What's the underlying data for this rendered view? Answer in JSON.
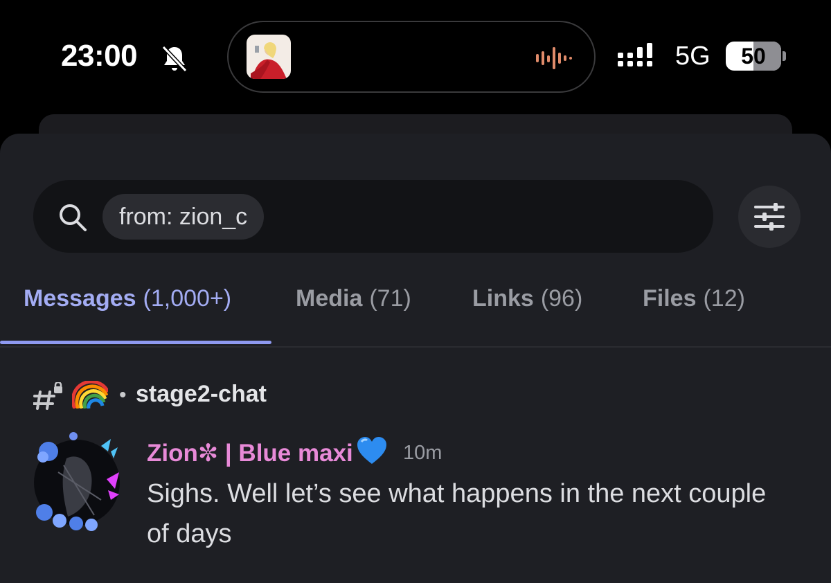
{
  "status_bar": {
    "time": "23:00",
    "bell_icon": "bell-slash-icon",
    "network": "5G",
    "battery": "50",
    "battery_level": 0.5
  },
  "search": {
    "filter_chip": "from: zion_c"
  },
  "tabs": [
    {
      "label": "Messages",
      "count": "(1,000+)",
      "active": true
    },
    {
      "label": "Media",
      "count": "(71)"
    },
    {
      "label": "Links",
      "count": "(96)"
    },
    {
      "label": "Files",
      "count": "(12)"
    }
  ],
  "result": {
    "channel": "stage2-chat",
    "author": "Zion✼ | Blue maxi",
    "time": "10m",
    "text": "Sighs. Well let’s see what happens in the next couple of days"
  },
  "colors": {
    "accent": "#8e99f0",
    "author": "#e88ad8",
    "background": "#1e1f24"
  }
}
